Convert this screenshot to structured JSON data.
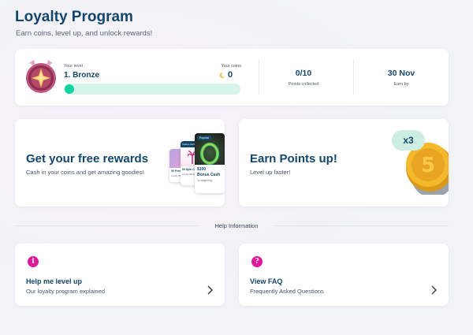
{
  "header": {
    "title": "Loyalty Program",
    "subtitle": "Earn coins, level up, and unlock rewards!"
  },
  "level": {
    "level_label": "Your level",
    "level_name": "1. Bronze",
    "coins_label": "Your coins",
    "coins_value": "0",
    "progress_fraction": 0,
    "points_value": "0/10",
    "points_label": "Points collected",
    "earn_by_value": "30 Nov",
    "earn_by_label": "Earn by"
  },
  "promos": {
    "rewards": {
      "title": "Get your free rewards",
      "subtitle": "Cash in your coins and get amazing goodies!",
      "card_popular": "Popular",
      "card_bonus_amount": "$100",
      "card_bonus_label": "Bonus Cash",
      "card_wagering": "1x wagering",
      "card_spins": "50 Spin C",
      "card_spins_sub": "Candy Blast",
      "card_free": "50 Free Sp",
      "card_free_sub": "Candy Blast",
      "card_header": "Casino cash"
    },
    "points": {
      "title": "Earn Points up!",
      "subtitle": "Level up faster!",
      "multiplier": "x3"
    }
  },
  "help": {
    "section_title": "Help Information",
    "level_up": {
      "title": "Help me level up",
      "subtitle": "Our loyalty program explained",
      "icon_glyph": "i"
    },
    "faq": {
      "title": "View FAQ",
      "subtitle": "Frequently Asked Questions",
      "icon_glyph": "?"
    }
  },
  "colors": {
    "primary_text": "#13466b",
    "progress_track": "#d6f4ea",
    "progress_knob": "#14d39e",
    "help_icon": "#e0199a",
    "coin_gold": "#f3b82c"
  }
}
